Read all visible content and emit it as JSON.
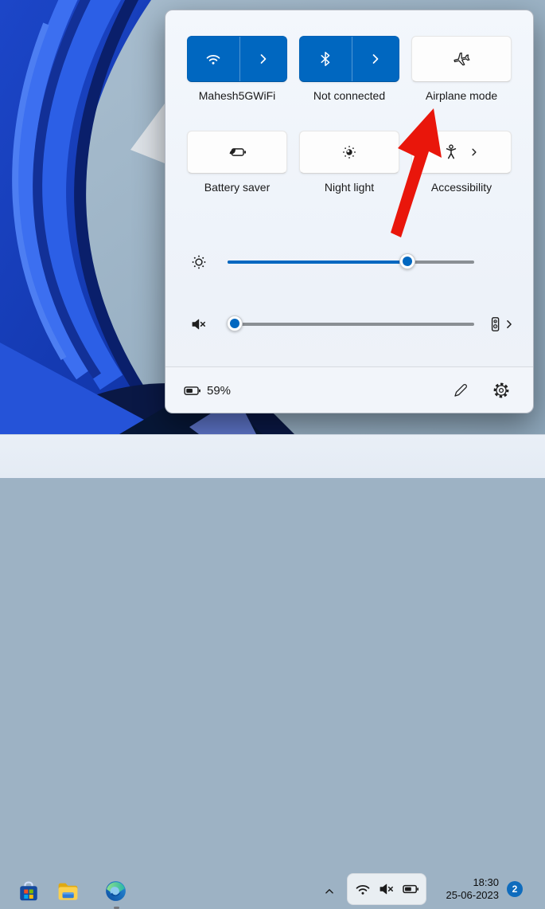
{
  "colors": {
    "accent": "#0067c0",
    "arrow_red": "#e9160b",
    "badge_blue": "#0f6cbd",
    "panel_bg": "#eff3fa",
    "taskbar_bg": "#e9eff7"
  },
  "quick_settings": {
    "tiles": {
      "wifi": {
        "label": "Mahesh5GWiFi",
        "icon": "wifi-icon",
        "state": "on",
        "has_expander": true
      },
      "bluetooth": {
        "label": "Not connected",
        "icon": "bluetooth-icon",
        "state": "on",
        "has_expander": true
      },
      "airplane": {
        "label": "Airplane mode",
        "icon": "airplane-icon",
        "state": "off",
        "has_expander": false
      },
      "battery_saver": {
        "label": "Battery saver",
        "icon": "battery-saver-icon",
        "state": "off",
        "has_expander": false
      },
      "night_light": {
        "label": "Night light",
        "icon": "night-light-icon",
        "state": "off",
        "has_expander": false
      },
      "accessibility": {
        "label": "Accessibility",
        "icon": "accessibility-icon",
        "state": "off",
        "has_expander": true
      }
    },
    "brightness": {
      "percent": 73
    },
    "volume": {
      "percent": 3,
      "muted": true
    },
    "footer": {
      "battery_percent": "59%"
    }
  },
  "taskbar": {
    "pinned_apps": [
      "microsoft-store",
      "file-explorer",
      "microsoft-edge"
    ],
    "edge_running": true,
    "tray": {
      "icons": [
        "wifi",
        "volume-muted",
        "battery"
      ],
      "time": "18:30",
      "date": "25-06-2023",
      "notification_count": "2"
    }
  }
}
